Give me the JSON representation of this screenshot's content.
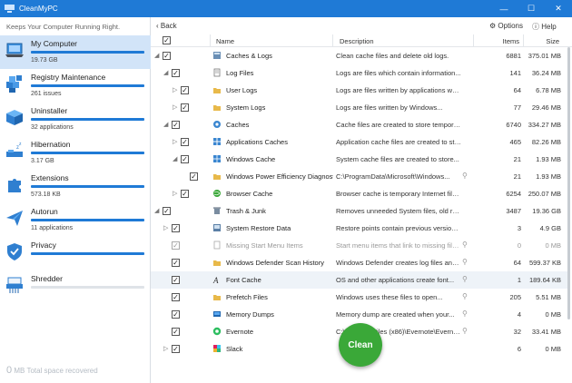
{
  "app": {
    "title": "CleanMyPC"
  },
  "sidebar": {
    "tagline": "Keeps Your Computer Running Right.",
    "items": [
      {
        "label": "My Computer",
        "sub": "19.73 GB",
        "icon": "laptop-icon",
        "active": true,
        "progress": 1.0
      },
      {
        "label": "Registry Maintenance",
        "sub": "261 issues",
        "icon": "registry-cubes-icon",
        "active": false,
        "progress": 1.0
      },
      {
        "label": "Uninstaller",
        "sub": "32 applications",
        "icon": "uninstaller-box-icon",
        "active": false,
        "progress": 1.0
      },
      {
        "label": "Hibernation",
        "sub": "3.17 GB",
        "icon": "hibernation-icon",
        "active": false,
        "progress": 1.0
      },
      {
        "label": "Extensions",
        "sub": "573.18 KB",
        "icon": "puzzle-piece-icon",
        "active": false,
        "progress": 1.0
      },
      {
        "label": "Autorun",
        "sub": "11 applications",
        "icon": "paper-plane-icon",
        "active": false,
        "progress": 1.0
      },
      {
        "label": "Privacy",
        "sub": "",
        "icon": "shield-icon",
        "active": false,
        "progress": 1.0
      },
      {
        "label": "Shredder",
        "sub": "",
        "icon": "shredder-icon",
        "active": false,
        "progress": 0.0
      }
    ],
    "recovered": {
      "amount": "0",
      "unit": "MB",
      "text": "Total space recovered"
    }
  },
  "toolbar": {
    "back_label": "Back",
    "options_label": "Options",
    "help_label": "Help"
  },
  "table": {
    "columns": {
      "name": "Name",
      "description": "Description",
      "items": "Items",
      "size": "Size"
    },
    "rows": [
      {
        "name": "Caches & Logs",
        "desc": "Clean cache files and delete old logs.",
        "items": "6881",
        "size": "375.01 MB"
      },
      {
        "name": "Log Files",
        "desc": "Logs are files which contain information...",
        "items": "141",
        "size": "36.24 MB"
      },
      {
        "name": "User Logs",
        "desc": "Logs are files written by applications which...",
        "items": "64",
        "size": "6.78 MB"
      },
      {
        "name": "System Logs",
        "desc": "Logs are files written by Windows...",
        "items": "77",
        "size": "29.46 MB"
      },
      {
        "name": "Caches",
        "desc": "Cache files are created to store temporary...",
        "items": "6740",
        "size": "334.27 MB"
      },
      {
        "name": "Applications Caches",
        "desc": "Application cache files are created to store...",
        "items": "465",
        "size": "82.26 MB"
      },
      {
        "name": "Windows Cache",
        "desc": "System cache files are created to store...",
        "items": "21",
        "size": "1.93 MB"
      },
      {
        "name": "Windows Power Efficiency Diagnostic",
        "desc": "C:\\ProgramData\\Microsoft\\Windows...",
        "items": "21",
        "size": "1.93 MB"
      },
      {
        "name": "Browser Cache",
        "desc": "Browser cache is temporary Internet files like...",
        "items": "6254",
        "size": "250.07 MB"
      },
      {
        "name": "Trash & Junk",
        "desc": "Removes unneeded System files, old restore...",
        "items": "3487",
        "size": "19.36 GB"
      },
      {
        "name": "System Restore Data",
        "desc": "Restore points contain previous versions of...",
        "items": "3",
        "size": "4.9 GB"
      },
      {
        "name": "Missing Start Menu Items",
        "desc": "Start menu items that link to missing files...",
        "items": "0",
        "size": "0 MB"
      },
      {
        "name": "Windows Defender Scan History",
        "desc": "Windows Defender creates log files and...",
        "items": "64",
        "size": "599.37 KB"
      },
      {
        "name": "Font Cache",
        "desc": "OS and other applications create font...",
        "items": "1",
        "size": "189.64 KB"
      },
      {
        "name": "Prefetch Files",
        "desc": "Windows uses these files to open...",
        "items": "205",
        "size": "5.51 MB"
      },
      {
        "name": "Memory Dumps",
        "desc": "Memory dump are created when your...",
        "items": "4",
        "size": "0 MB"
      },
      {
        "name": "Evernote",
        "desc": "C:\\Program Files (x86)\\Evernote\\Evernote...",
        "items": "32",
        "size": "33.41 MB"
      },
      {
        "name": "Slack",
        "desc": "",
        "items": "6",
        "size": "0 MB"
      }
    ]
  },
  "clean_button": {
    "label": "Clean"
  },
  "colors": {
    "accent": "#1f7ad6",
    "clean_green": "#3aa838",
    "active_bg": "#d2e4f8"
  }
}
